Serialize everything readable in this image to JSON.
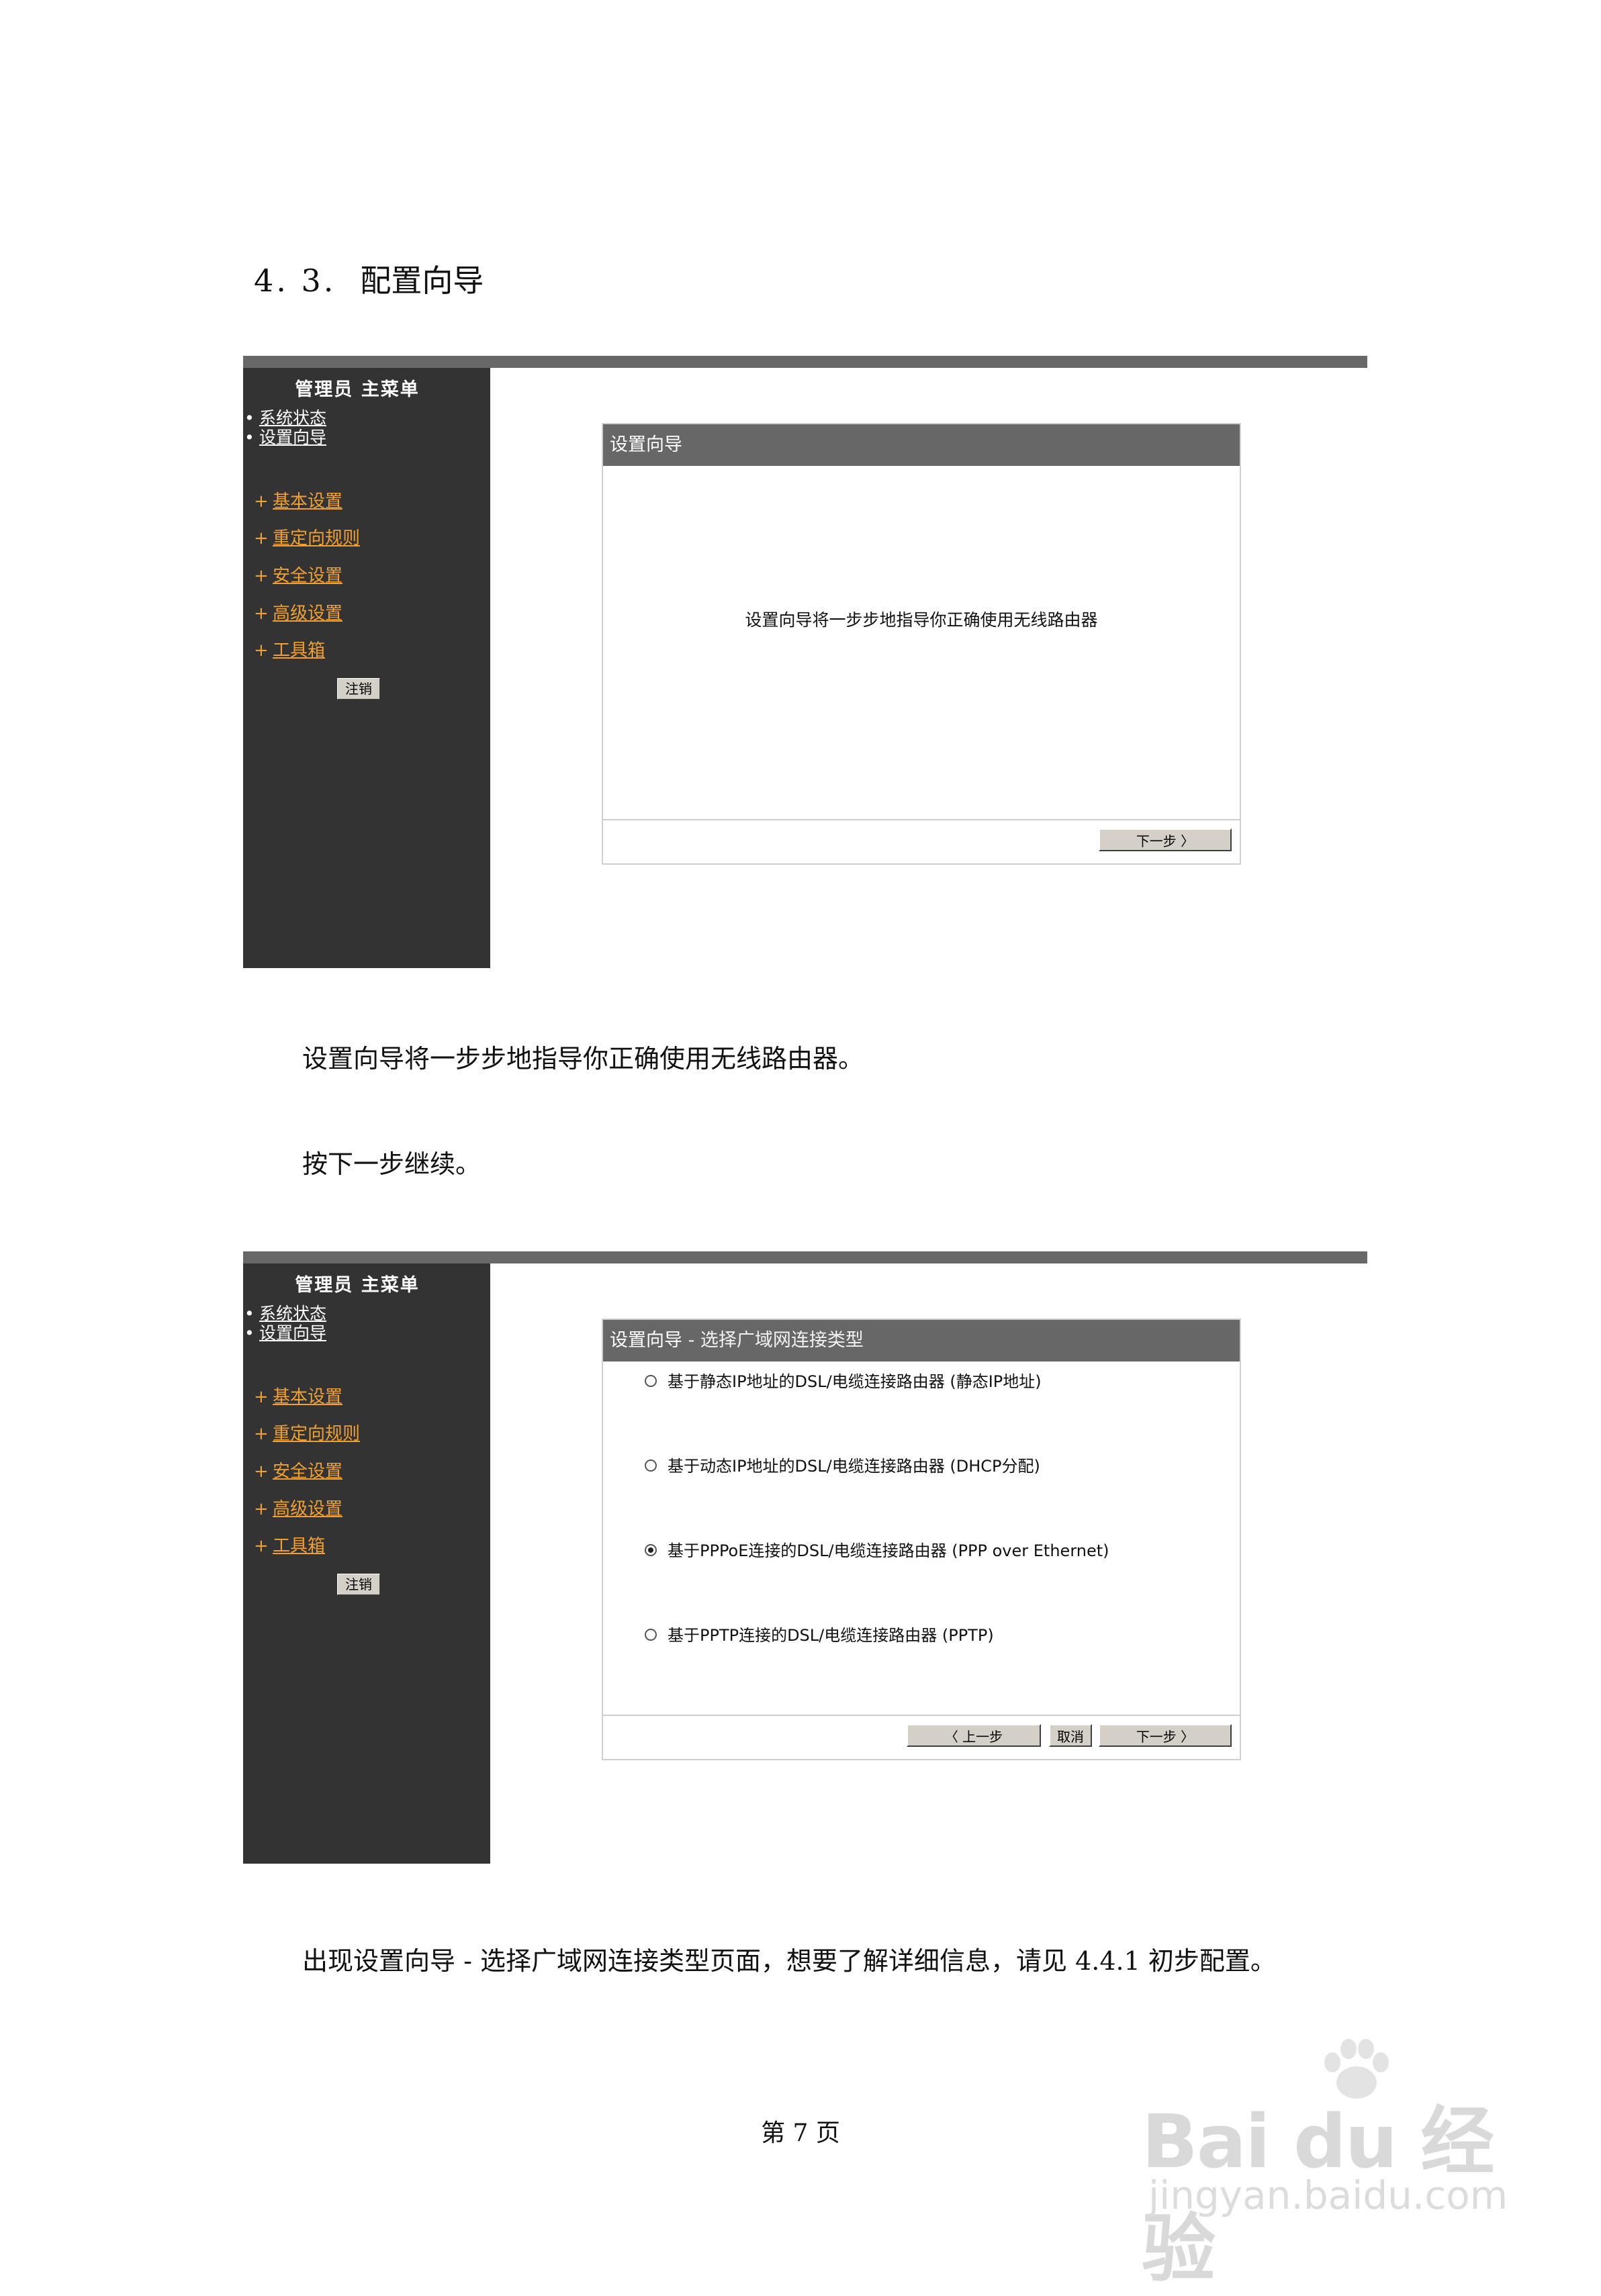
{
  "heading": {
    "number": "4. 3.",
    "title": "配置向导"
  },
  "screenshot1": {
    "menu_title": "管理员 主菜单",
    "bullets": [
      {
        "label": "系统状态"
      },
      {
        "label": "设置向导"
      }
    ],
    "categories": [
      {
        "plus": "+",
        "label": "基本设置"
      },
      {
        "plus": "+",
        "label": "重定向规则"
      },
      {
        "plus": "+",
        "label": "安全设置"
      },
      {
        "plus": "+",
        "label": "高级设置"
      },
      {
        "plus": "+",
        "label": "工具箱"
      }
    ],
    "logout": "注销",
    "panel_title": "设置向导",
    "message": "设置向导将一步步地指导你正确使用无线路由器",
    "next_button": "下一步 〉"
  },
  "paragraph1": "设置向导将一步步地指导你正确使用无线路由器。",
  "paragraph2": "按下一步继续。",
  "screenshot2": {
    "menu_title": "管理员 主菜单",
    "bullets": [
      {
        "label": "系统状态"
      },
      {
        "label": "设置向导"
      }
    ],
    "categories": [
      {
        "plus": "+",
        "label": "基本设置"
      },
      {
        "plus": "+",
        "label": "重定向规则"
      },
      {
        "plus": "+",
        "label": "安全设置"
      },
      {
        "plus": "+",
        "label": "高级设置"
      },
      {
        "plus": "+",
        "label": "工具箱"
      }
    ],
    "logout": "注销",
    "panel_title": "设置向导",
    "panel_subtitle": " - 选择广域网连接类型",
    "options": [
      {
        "label": "基于静态IP地址的DSL/电缆连接路由器 (静态IP地址)",
        "checked": false
      },
      {
        "label": "基于动态IP地址的DSL/电缆连接路由器 (DHCP分配)",
        "checked": false
      },
      {
        "label": "基于PPPoE连接的DSL/电缆连接路由器  (PPP over Ethernet)",
        "checked": true
      },
      {
        "label": "基于PPTP连接的DSL/电缆连接路由器 (PPTP)",
        "checked": false
      }
    ],
    "prev_button": "〈 上一步",
    "cancel_button": "取消",
    "next_button": "下一步 〉"
  },
  "paragraph3": "出现设置向导 - 选择广域网连接类型页面，想要了解详细信息，请见 4.4.1 初步配置。",
  "page_footer": "第 7 页",
  "watermark": {
    "brand": "Bai du 经验",
    "url": "jingyan.baidu.com"
  }
}
